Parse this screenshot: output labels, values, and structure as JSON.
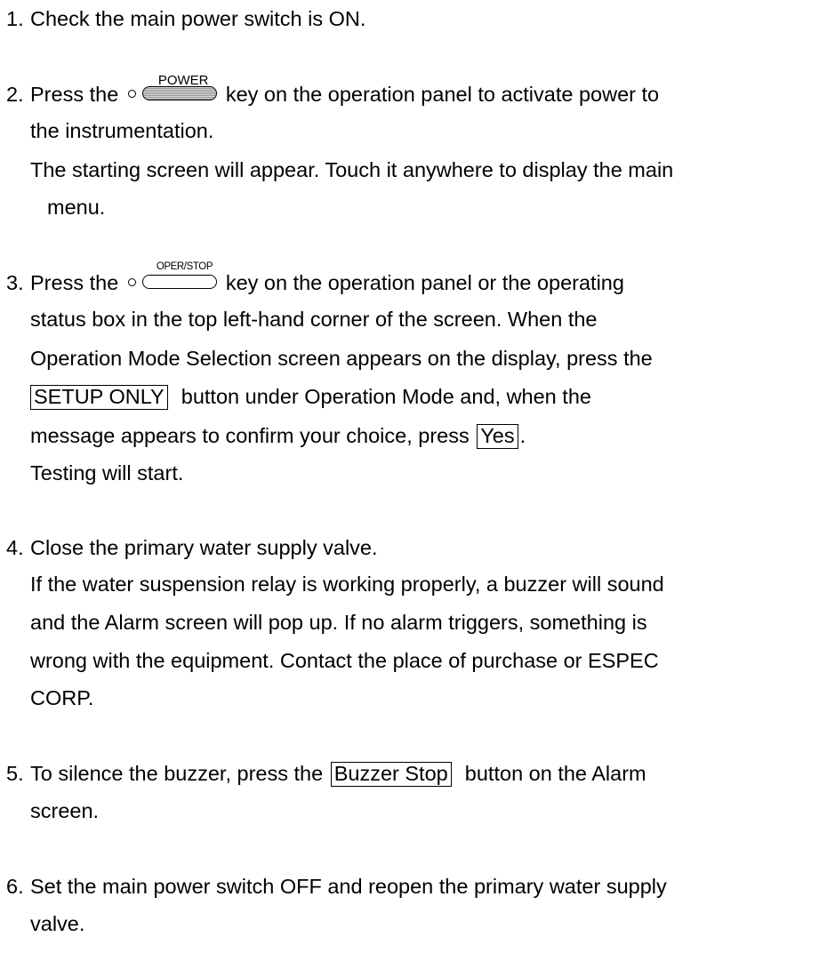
{
  "steps": [
    {
      "num": "1.",
      "lines": [
        "Check the main power switch is ON."
      ]
    },
    {
      "num": "2.",
      "pre": "Press the",
      "key_label": "POWER",
      "post": "key on the operation panel to activate power to",
      "lines": [
        "the instrumentation.",
        "The starting screen will appear. Touch it anywhere to display the main",
        "menu."
      ]
    },
    {
      "num": "3.",
      "pre": "Press the",
      "key_label": "OPER/STOP",
      "post": "key on the operation panel or the operating",
      "lines": [
        "status box in the top left-hand corner of the screen. When the",
        "Operation Mode Selection screen appears on the display, press the"
      ],
      "setup_button": "SETUP ONLY",
      "setup_tail": "button under Operation Mode and, when the",
      "confirm_pre": "message appears to confirm your choice, press",
      "yes_button": "Yes",
      "confirm_post": ".",
      "testing": "Testing will start."
    },
    {
      "num": "4.",
      "lines": [
        "Close the primary water supply valve.",
        "If the water suspension relay is working properly, a buzzer will sound",
        "and the Alarm screen will pop up. If no alarm triggers, something is",
        "wrong with the equipment. Contact the place of purchase or ESPEC",
        "CORP."
      ]
    },
    {
      "num": "5.",
      "pre": "To silence the buzzer, press the",
      "button": "Buzzer Stop",
      "post": "button on the Alarm",
      "lines": [
        "screen."
      ]
    },
    {
      "num": "6.",
      "lines": [
        "Set the main power switch OFF and reopen the primary water supply",
        "valve."
      ]
    }
  ]
}
